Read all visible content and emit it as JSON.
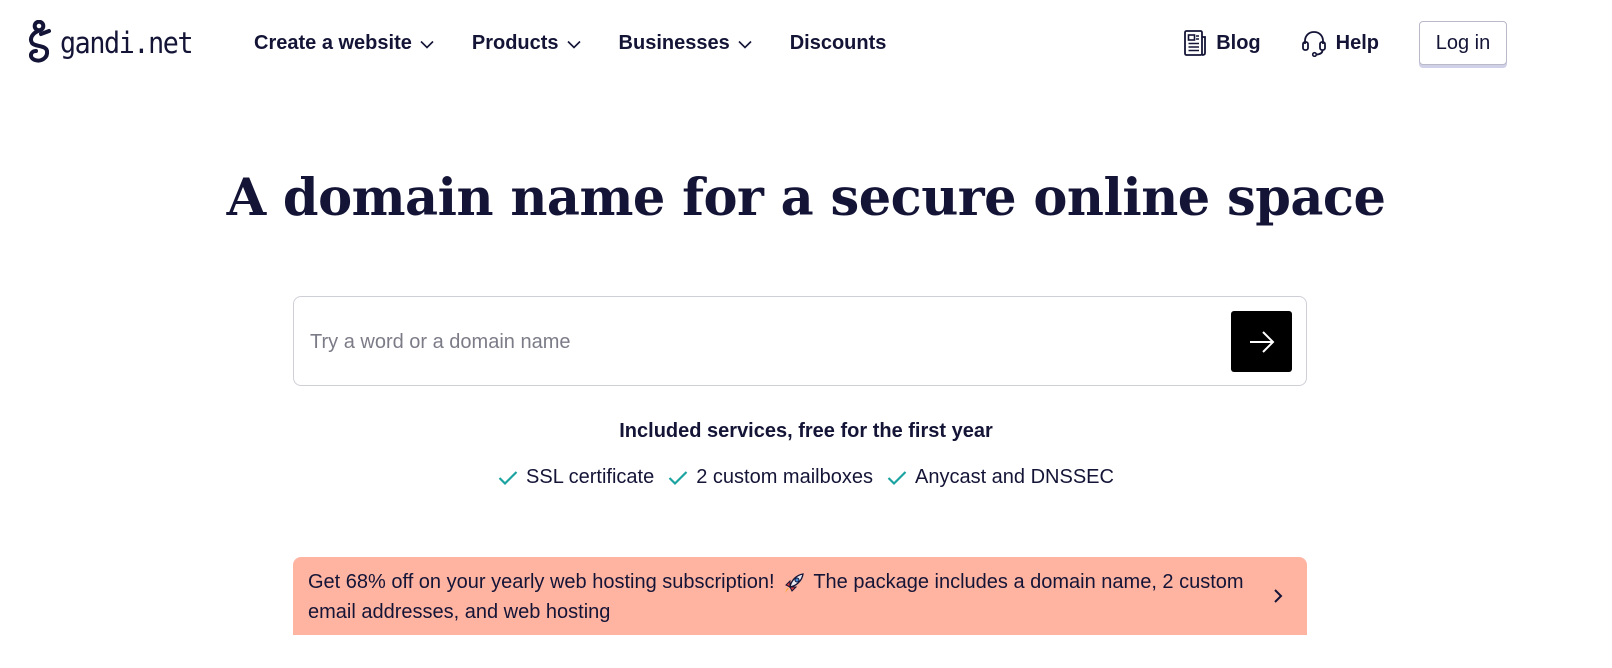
{
  "header": {
    "logo_text": "gandi.net",
    "nav": [
      {
        "label": "Create a website",
        "has_dropdown": true
      },
      {
        "label": "Products",
        "has_dropdown": true
      },
      {
        "label": "Businesses",
        "has_dropdown": true
      },
      {
        "label": "Discounts",
        "has_dropdown": false
      }
    ],
    "blog_label": "Blog",
    "help_label": "Help",
    "login_label": "Log in"
  },
  "hero": {
    "title": "A domain name for a secure online space",
    "search_placeholder": "Try a word or a domain name",
    "search_value": ""
  },
  "included": {
    "heading": "Included services, free for the first year",
    "features": [
      "SSL certificate",
      "2 custom mailboxes",
      "Anycast and DNSSEC"
    ]
  },
  "promo": {
    "text_before": "Get 68% off on your yearly web hosting subscription!",
    "emoji": "rocket",
    "text_after": "The package includes a domain name, 2 custom email addresses, and web hosting"
  },
  "colors": {
    "text": "#141437",
    "check": "#1aa3a0",
    "promo_bg": "#ffb4a1",
    "search_button": "#000000"
  }
}
